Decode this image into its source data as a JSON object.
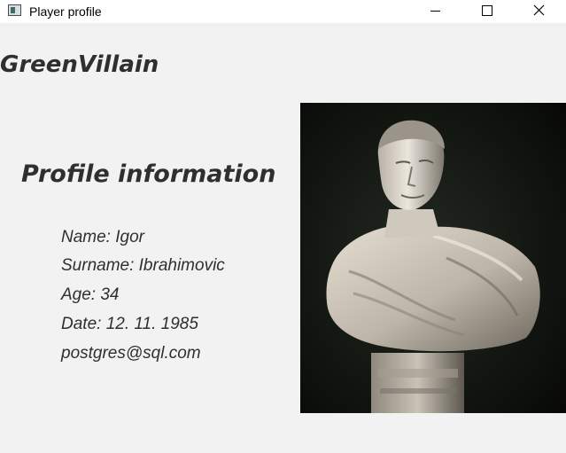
{
  "window": {
    "title": "Player profile",
    "icon": "app-window-icon"
  },
  "profile": {
    "username": "GreenVillain",
    "section_title": "Profile information",
    "fields": {
      "name": "Name: Igor",
      "surname": "Surname: Ibrahimovic",
      "age": "Age: 34",
      "date": "Date: 12. 11. 1985",
      "email": "postgres@sql.com"
    },
    "photo": "bust-portrait-image"
  },
  "colors": {
    "titlebar_bg": "#ffffff",
    "content_bg": "#f2f2f2",
    "text": "#2f2f2f"
  }
}
